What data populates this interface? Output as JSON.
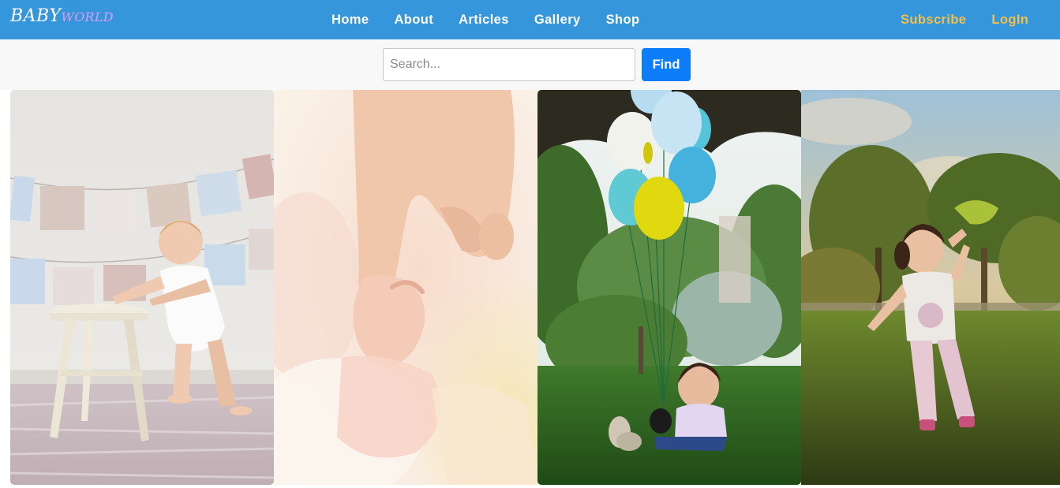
{
  "brand": {
    "part1": "BABY",
    "part2": "WORLD"
  },
  "nav": {
    "links": [
      "Home",
      "About",
      "Articles",
      "Gallery",
      "Shop"
    ],
    "subscribe": "Subscribe",
    "login": "LogIn"
  },
  "search": {
    "placeholder": "Search...",
    "value": "",
    "button": "Find"
  },
  "gallery": {
    "photos": [
      {
        "icon": "baby-standing-by-stool-photo"
      },
      {
        "icon": "baby-holding-adult-finger-photo"
      },
      {
        "icon": "baby-with-balloons-in-park-photo"
      },
      {
        "icon": "toddler-walking-in-grass-photo"
      }
    ]
  },
  "colors": {
    "navbar": "#3596db",
    "accent_links": "#f1c04b",
    "brand_secondary": "#d89cf0",
    "find_button": "#0d7dfa",
    "searchbar_bg": "#f8f8f8"
  }
}
